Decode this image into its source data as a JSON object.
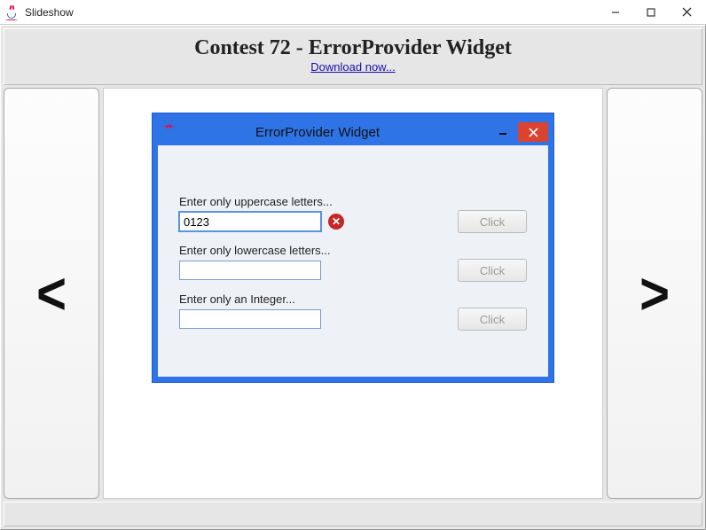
{
  "window": {
    "title": "Slideshow"
  },
  "header": {
    "title": "Contest 72 - ErrorProvider Widget",
    "link_text": "Download now..."
  },
  "nav": {
    "prev_glyph": "<",
    "next_glyph": ">"
  },
  "slide": {
    "inner_title": "ErrorProvider Widget",
    "fields": [
      {
        "label": "Enter only uppercase letters...",
        "value": "0123",
        "has_error": true,
        "button": "Click",
        "focused": true
      },
      {
        "label": "Enter only lowercase letters...",
        "value": "",
        "has_error": false,
        "button": "Click",
        "focused": false
      },
      {
        "label": "Enter only an Integer...",
        "value": "",
        "has_error": false,
        "button": "Click",
        "focused": false
      }
    ]
  }
}
